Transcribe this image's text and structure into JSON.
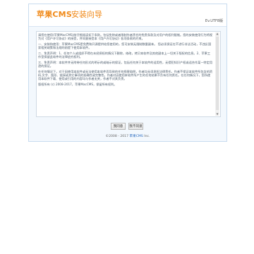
{
  "header": {
    "logo": "苹果CMS",
    "title": "安装向导",
    "version": "Ev.UTF8版"
  },
  "license": {
    "paragraphs": [
      "请您在使用(苹果MacCMS)前仔细阅读如下条款。包括免除或者限制作者责任的免责条款及对用户的权利限制。您的安装使用行为将视为对《用户许可协议》的接受，并同意接受本《用户许可协议》各项条款的约束。",
      "一、安装和使用：苹果MacCMS是免费和开源提供给您使用的，您可安装无限制数量副本。 您必须保证在不进行非法活动，不违反国家相关政策和法规的前提下使用本软件。",
      "二、免责声明：1、任何个人或组织不得在未经授权的情况下删除，修改，拷贝本软件及其他副本上一切关于版权的信息。2、苹果工作室保留此软件的法律追究权利。",
      "三、免责声明：本软件并无附带任何形式的明示的或暗示的保证，包括任何关于本软件的适用性，无侵犯知识产权或适合作某一特定用途的保证。",
      "在任何情况下，对于因使用本软件或无法使用本软件而导致的任何损害赔偿，作者均无须承担法律责任。作者不保证本软件所包含的资料,文字、图形、链接或其它事项的准确性或完整性。作者对因使用本软件所产生的任何结果不负有任何责任。在任何情况下，您所使用本软件下载、使用或引用的内容均与作者无关，作者不对其负责。",
      "版权所有 (c) 2008-2017，苹果MacCMS，保留所有权利。"
    ]
  },
  "buttons": {
    "agree": "我同意",
    "disagree": "我不同意"
  },
  "footer": {
    "prefix": "©2008 - 2017",
    "brand": "苹果CMS",
    "suffix": "Inc."
  },
  "icons": {
    "scroll_up": "triangle-up",
    "scroll_down": "triangle-down"
  },
  "colors": {
    "accent": "#f08a1a",
    "brand_link": "#2b6bbf",
    "panel_background": "#f3f8fd"
  }
}
